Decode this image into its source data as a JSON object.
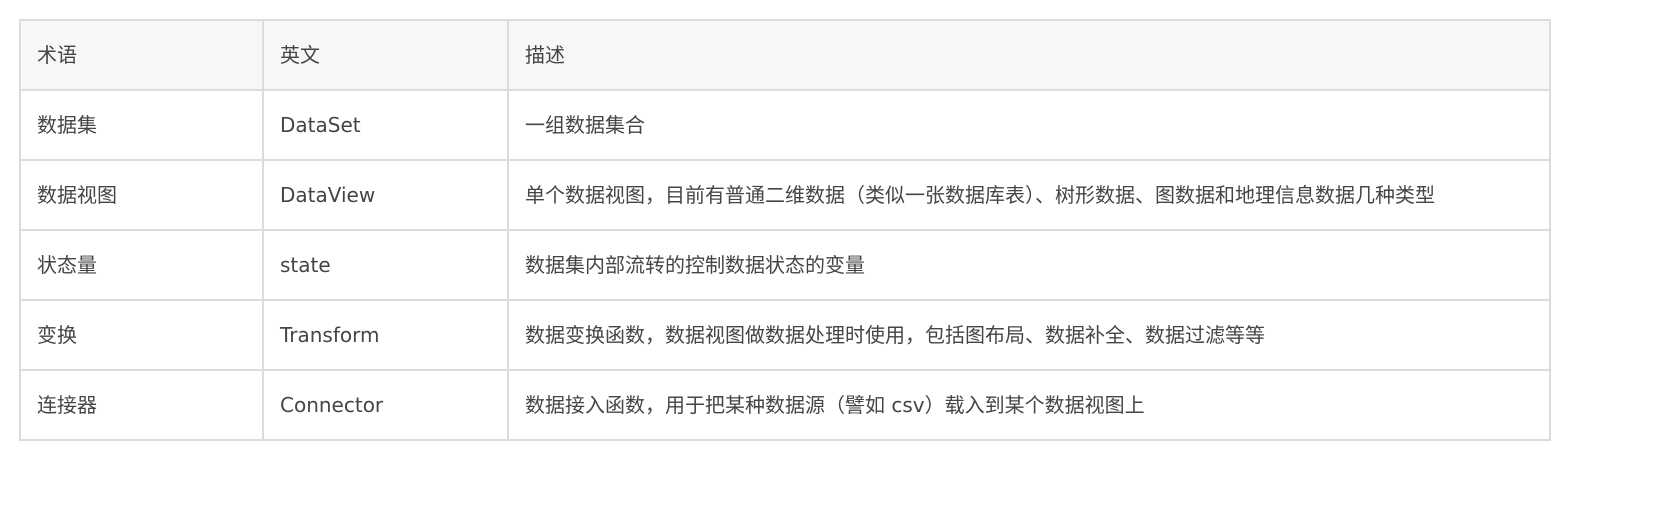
{
  "table": {
    "headers": [
      "术语",
      "英文",
      "描述"
    ],
    "rows": [
      {
        "term": "数据集",
        "english": "DataSet",
        "description": "一组数据集合"
      },
      {
        "term": "数据视图",
        "english": "DataView",
        "description": "单个数据视图，目前有普通二维数据（类似一张数据库表）、树形数据、图数据和地理信息数据几种类型"
      },
      {
        "term": "状态量",
        "english": "state",
        "description": "数据集内部流转的控制数据状态的变量"
      },
      {
        "term": "变换",
        "english": "Transform",
        "description": "数据变换函数，数据视图做数据处理时使用，包括图布局、数据补全、数据过滤等等"
      },
      {
        "term": "连接器",
        "english": "Connector",
        "description": "数据接入函数，用于把某种数据源（譬如 csv）载入到某个数据视图上"
      }
    ]
  }
}
